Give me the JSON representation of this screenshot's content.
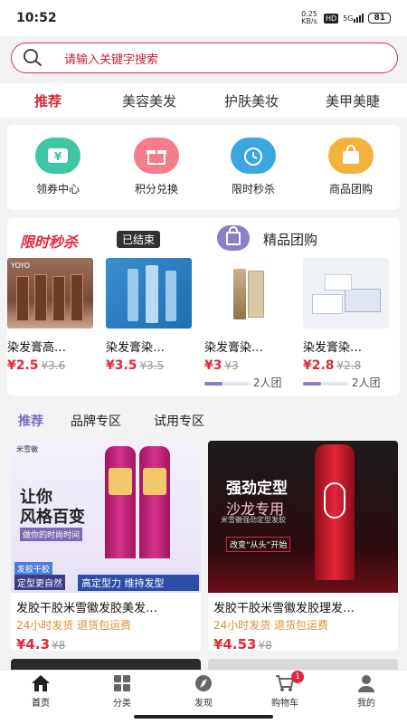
{
  "status": {
    "time": "10:52",
    "speed": "0.25 KB/s",
    "hd": "HD",
    "signal": "5G",
    "battery": "81"
  },
  "search": {
    "placeholder": "请输入关键字搜索"
  },
  "tabs": [
    "推荐",
    "美容美发",
    "护肤美妆",
    "美甲美睫"
  ],
  "categories": [
    "领券中心",
    "积分兑换",
    "限时秒杀",
    "商品团购"
  ],
  "flash": {
    "title": "限时秒杀",
    "status": "已结束",
    "items": [
      {
        "name": "染发膏高…",
        "price": "¥2.5",
        "old": "¥3.6"
      },
      {
        "name": "染发膏染…",
        "price": "¥3.5",
        "old": "¥3.5"
      }
    ]
  },
  "group": {
    "title": "精品团购",
    "items": [
      {
        "name": "染发膏染…",
        "price": "¥3",
        "old": "¥3",
        "count": "2人团",
        "progress": 0.4
      },
      {
        "name": "染发膏染…",
        "price": "¥2.8",
        "old": "¥2.8",
        "count": "2人团",
        "progress": 0.4
      }
    ]
  },
  "sub_tabs": [
    "推荐",
    "品牌专区",
    "试用专区"
  ],
  "products": [
    {
      "name": "发胶干胶米雪徽发胶美发…",
      "tag": "24小时发货 退货包运费",
      "price": "¥4.3",
      "old": "¥8",
      "img_text": {
        "brand": "米雪徽",
        "line1": "让你",
        "line2": "风格百变",
        "sub": "做你的时尚时间",
        "b1": "发胶干胶",
        "b2": "定型更自然",
        "b3": "高定型力 维持发型"
      }
    },
    {
      "name": "发胶干胶米雪徽发胶理发…",
      "tag": "24小时发货 退货包运费",
      "price": "¥4.53",
      "old": "¥8",
      "img_text": {
        "line1": "强劲定型",
        "line2": "沙龙专用",
        "line3": "米雪徽强劲定型发胶",
        "line4": "改变“从头”开始"
      }
    }
  ],
  "bottom_nav": [
    {
      "label": "首页",
      "icon": "home-icon"
    },
    {
      "label": "分类",
      "icon": "category-icon"
    },
    {
      "label": "发现",
      "icon": "compass-icon"
    },
    {
      "label": "购物车",
      "icon": "cart-icon",
      "badge": "1"
    },
    {
      "label": "我的",
      "icon": "profile-icon"
    }
  ]
}
